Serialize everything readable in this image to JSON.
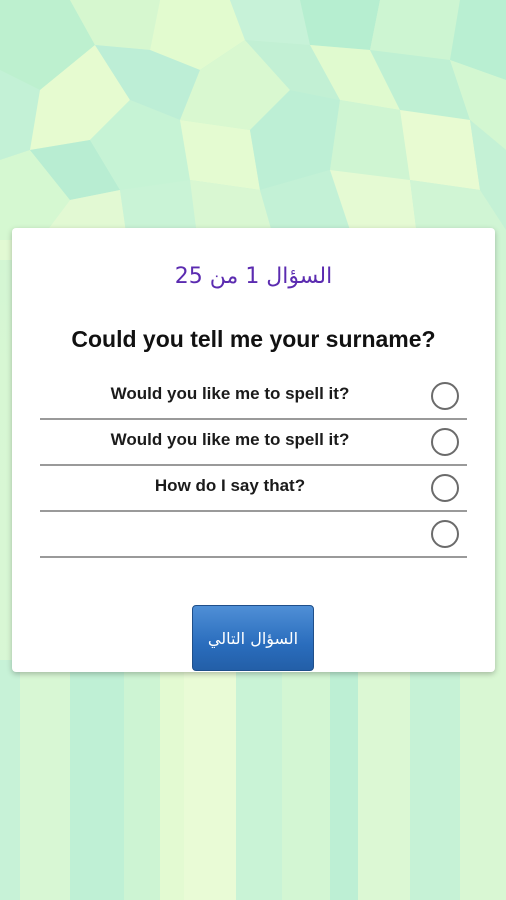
{
  "quiz": {
    "counter": "السؤال 1 من 25",
    "question": "Could you tell me your surname?",
    "options": [
      {
        "label": "Would you like me to spell it?",
        "selected": false
      },
      {
        "label": "Would you like me to spell it?",
        "selected": false
      },
      {
        "label": "How do I say that?",
        "selected": false
      },
      {
        "label": "",
        "selected": false
      }
    ],
    "next_label": "السؤال التالي"
  },
  "colors": {
    "counter_text": "#5b2bb0",
    "button": "#2a6dbd",
    "background": "#c8f2d4"
  }
}
